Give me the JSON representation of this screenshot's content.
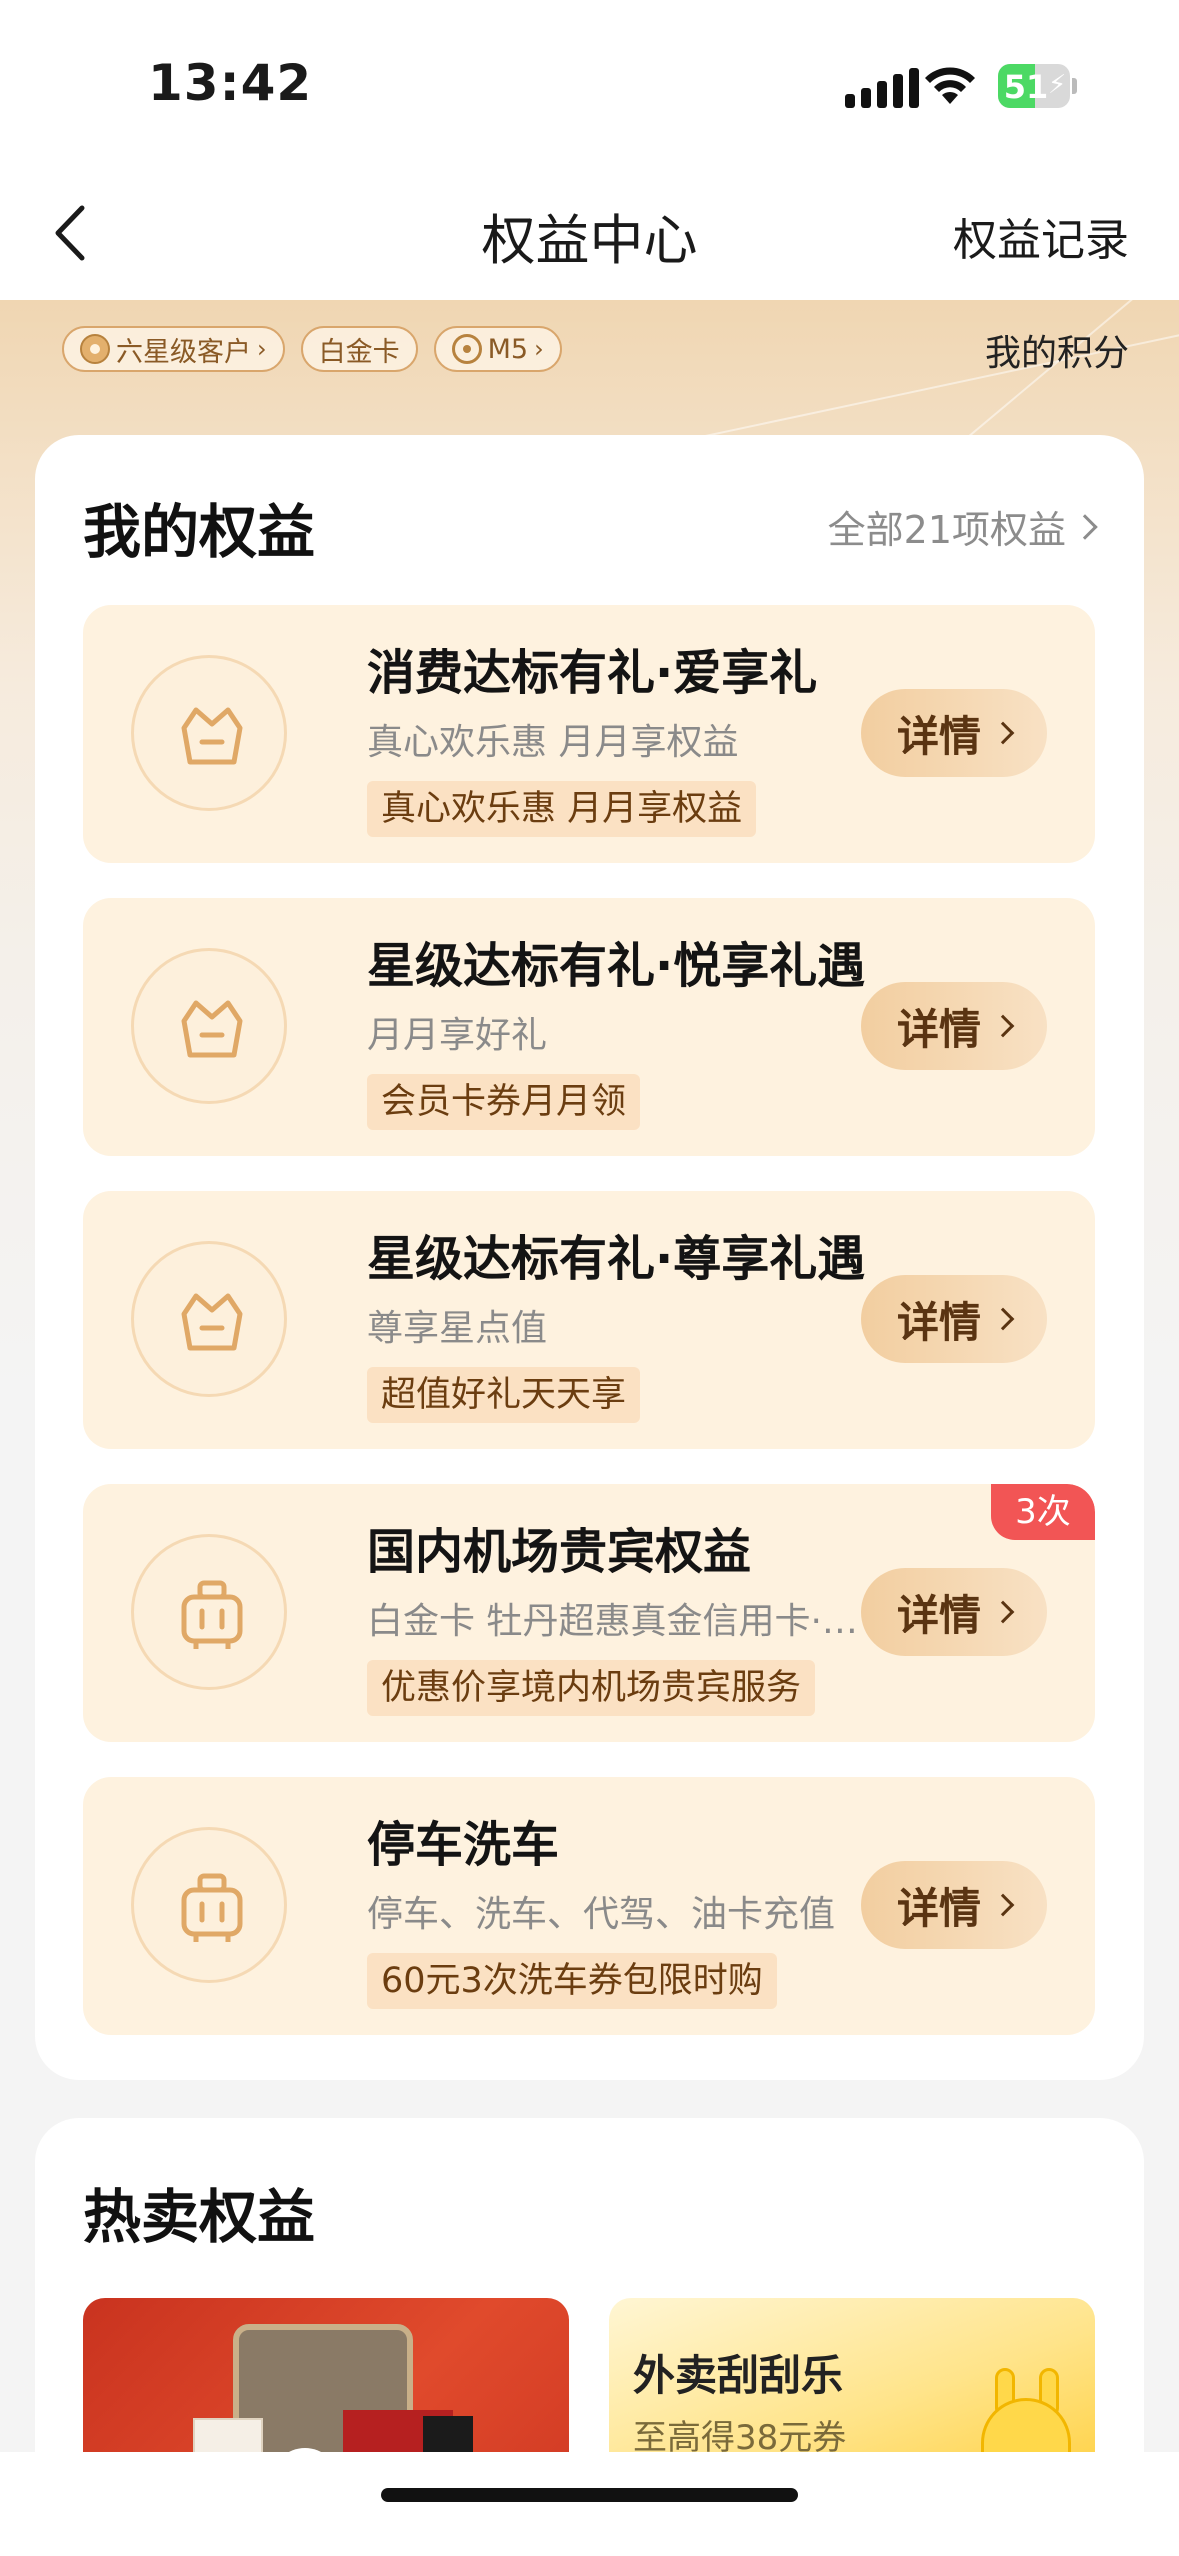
{
  "status_bar": {
    "time": "13:42",
    "battery": "51",
    "battery_level_percent": 51
  },
  "nav": {
    "title": "权益中心",
    "right_link": "权益记录"
  },
  "header": {
    "chips": [
      {
        "label": "六星级客户",
        "icon": "star-medal-icon",
        "arrow": true
      },
      {
        "label": "白金卡",
        "arrow": false
      },
      {
        "label": "M5",
        "icon": "wheel-icon",
        "arrow": true
      }
    ],
    "points_label": "我的积分"
  },
  "my_rights": {
    "title": "我的权益",
    "more_label": "全部21项权益",
    "detail_label": "详情",
    "items": [
      {
        "icon": "basket-icon",
        "title": "消费达标有礼·爱享礼",
        "subtitle": "真心欢乐惠 月月享权益",
        "tag": "真心欢乐惠 月月享权益",
        "badge": ""
      },
      {
        "icon": "basket-icon",
        "title": "星级达标有礼·悦享礼遇",
        "subtitle": "月月享好礼",
        "tag": "会员卡券月月领",
        "badge": ""
      },
      {
        "icon": "basket-icon",
        "title": "星级达标有礼·尊享礼遇",
        "subtitle": "尊享星点值",
        "tag": "超值好礼天天享",
        "badge": ""
      },
      {
        "icon": "luggage-icon",
        "title": "国内机场贵宾权益",
        "subtitle": "白金卡 牡丹超惠真金信用卡·…",
        "tag": "优惠价享境内机场贵宾服务",
        "badge": "3次"
      },
      {
        "icon": "luggage-icon",
        "title": "停车洗车",
        "subtitle": "停车、洗车、代驾、油卡充值",
        "tag": "60元3次洗车券包限时购",
        "badge": ""
      }
    ]
  },
  "hot": {
    "title": "热卖权益",
    "right_card": {
      "title": "外卖刮刮乐",
      "subtitle": "至高得38元券"
    }
  },
  "colors": {
    "accent_brown": "#5a3412",
    "card_bg": "#fef2df",
    "tag_bg": "#fbe1c3",
    "badge_red": "#f25555"
  }
}
